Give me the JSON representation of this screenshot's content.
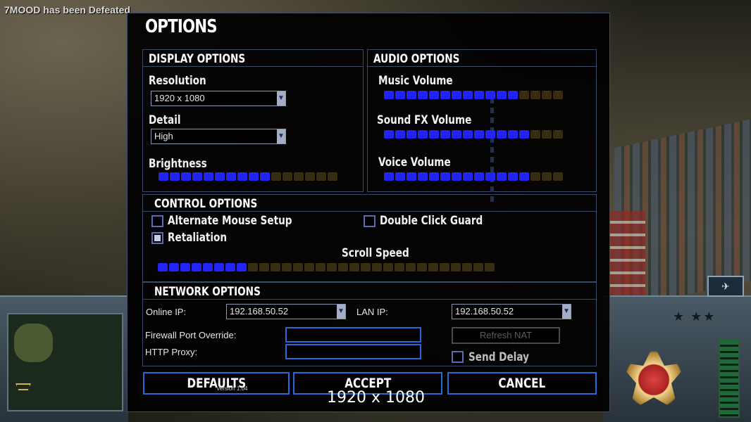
{
  "game_message": "7MOOD has been Defeated",
  "window_title": "OPTIONS",
  "display": {
    "title": "DISPLAY OPTIONS",
    "resolution_label": "Resolution",
    "resolution_value": "1920 x 1080",
    "detail_label": "Detail",
    "detail_value": "High",
    "brightness_label": "Brightness",
    "brightness_level": 10,
    "brightness_max": 16
  },
  "audio": {
    "title": "AUDIO OPTIONS",
    "music_label": "Music Volume",
    "music_level": 12,
    "music_max": 16,
    "sfx_label": "Sound FX Volume",
    "sfx_level": 13,
    "sfx_max": 16,
    "voice_label": "Voice Volume",
    "voice_level": 13,
    "voice_max": 16
  },
  "control": {
    "title": "CONTROL OPTIONS",
    "alt_mouse_label": "Alternate Mouse Setup",
    "alt_mouse_checked": false,
    "double_click_label": "Double Click Guard",
    "double_click_checked": false,
    "retaliation_label": "Retaliation",
    "retaliation_checked": true,
    "scroll_label": "Scroll Speed",
    "scroll_level": 8,
    "scroll_max": 30
  },
  "network": {
    "title": "NETWORK OPTIONS",
    "online_ip_label": "Online IP:",
    "online_ip_value": "192.168.50.52",
    "lan_ip_label": "LAN IP:",
    "lan_ip_value": "192.168.50.52",
    "firewall_label": "Firewall Port Override:",
    "firewall_value": "",
    "proxy_label": "HTTP Proxy:",
    "proxy_value": "",
    "refresh_nat_label": "Refresh NAT",
    "send_delay_label": "Send Delay",
    "send_delay_checked": false
  },
  "buttons": {
    "defaults": "DEFAULTS",
    "accept": "ACCEPT",
    "cancel": "CANCEL"
  },
  "version_text": "Version 1.04",
  "resolution_caption": "1920 x 1080",
  "colors": {
    "slider_on": "#2323f5",
    "slider_off": "#3a2c10",
    "button_border": "#2a6ad6",
    "panel_border": "#3a4a68"
  }
}
